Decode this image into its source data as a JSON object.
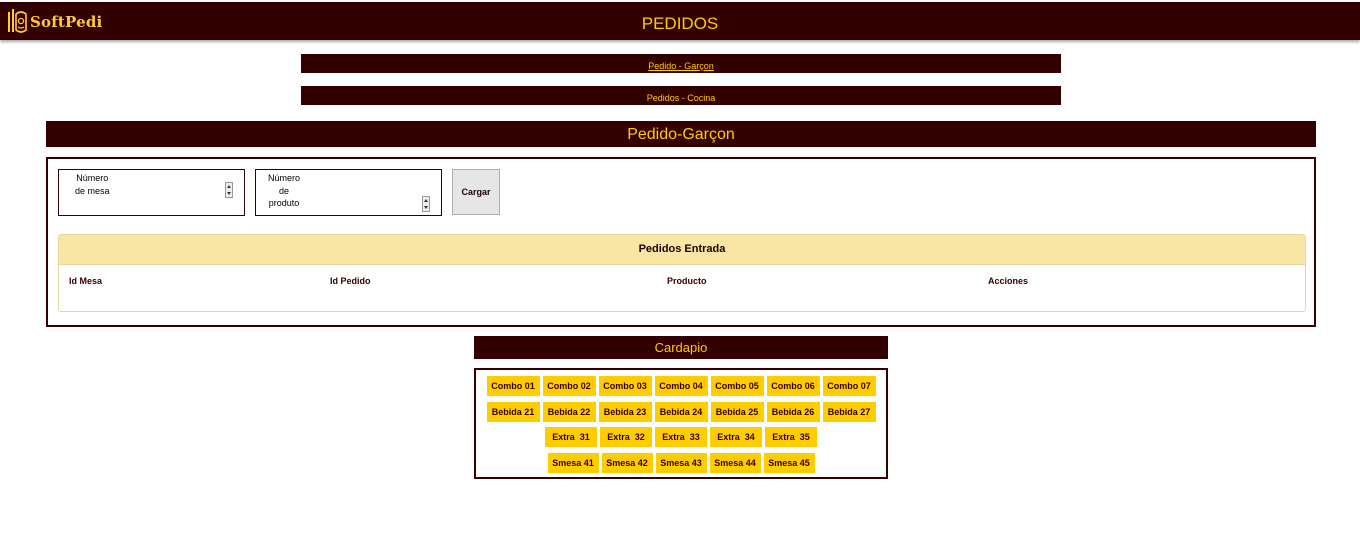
{
  "header": {
    "logo_text": "SoftPedi",
    "title": "PEDIDOS"
  },
  "nav": {
    "link_garcon": "Pedido - Garçon",
    "link_cocina": "Pedidos - Cocina"
  },
  "section": {
    "title": "Pedido-Garçon"
  },
  "form": {
    "mesa_placeholder": "Número\nde mesa",
    "produto_placeholder": "Número\nde\nproduto",
    "cargar_label": "Cargar"
  },
  "pedidos": {
    "heading": "Pedidos Entrada",
    "columns": [
      "Id Mesa",
      "Id Pedido",
      "Producto",
      "Acciones"
    ]
  },
  "cardapio": {
    "title": "Cardapio",
    "rows": [
      [
        "Combo 01",
        "Combo 02",
        "Combo 03",
        "Combo 04",
        "Combo 05",
        "Combo 06",
        "Combo 07"
      ],
      [
        "Bebida 21",
        "Bebida 22",
        "Bebida 23",
        "Bebida 24",
        "Bebida 25",
        "Bebida 26",
        "Bebida 27"
      ],
      [
        "Extra  31",
        "Extra  32",
        "Extra  33",
        "Extra  34",
        "Extra  35"
      ],
      [
        "Smesa 41",
        "Smesa 42",
        "Smesa 43",
        "Smesa 44",
        "Smesa 45"
      ]
    ]
  },
  "colors": {
    "brand_dark": "#330000",
    "accent_yellow": "#ffcc00",
    "panel_heading": "#f9e6a4"
  }
}
